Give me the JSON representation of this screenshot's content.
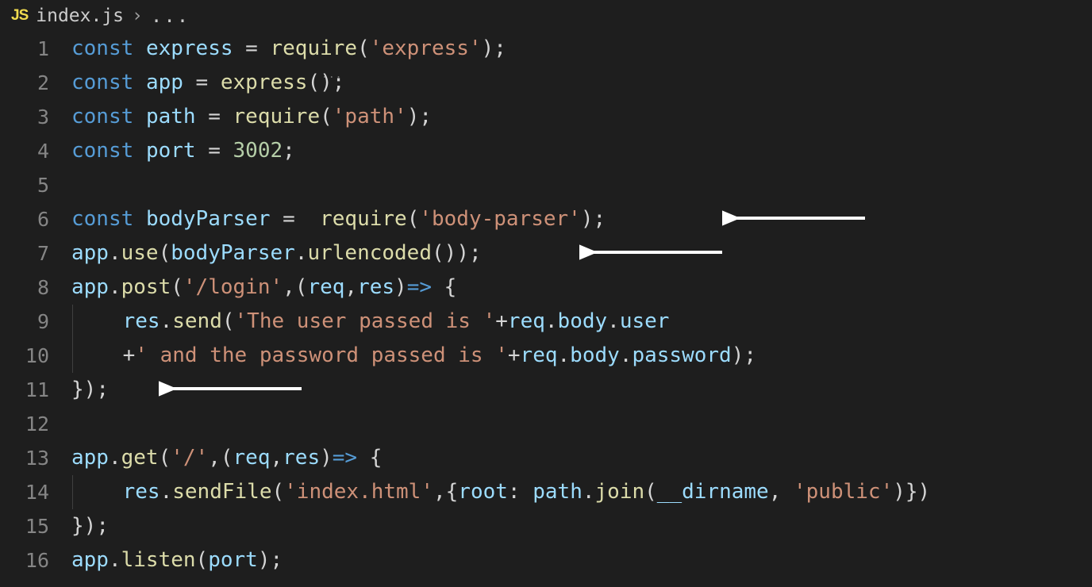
{
  "breadcrumb": {
    "fileIcon": "JS",
    "fileName": "index.js",
    "chevron": "›",
    "dots": "..."
  },
  "gutter": {
    "numbers": [
      "1",
      "2",
      "3",
      "4",
      "5",
      "6",
      "7",
      "8",
      "9",
      "10",
      "11",
      "12",
      "13",
      "14",
      "15",
      "16"
    ]
  },
  "code": {
    "l1": {
      "kw": "const",
      "var": "express",
      "eq": " = ",
      "fn": "require",
      "open": "(",
      "str": "'express'",
      "close": ")",
      "semi": ";"
    },
    "l2": {
      "kw": "const",
      "var": "app",
      "eq": " = ",
      "fn": "express",
      "open": "(",
      "close": ")",
      "semi": ";"
    },
    "l3": {
      "kw": "const",
      "var": "path",
      "eq": " = ",
      "fn": "require",
      "open": "(",
      "str": "'path'",
      "close": ")",
      "semi": ";"
    },
    "l4": {
      "kw": "const",
      "var": "port",
      "eq": " = ",
      "num": "3002",
      "semi": ";"
    },
    "l6": {
      "kw": "const",
      "var": "bodyParser",
      "eq": " =  ",
      "fn": "require",
      "open": "(",
      "str": "'body-parser'",
      "close": ")",
      "semi": ";"
    },
    "l7": {
      "obj": "app",
      "dot1": ".",
      "fn1": "use",
      "open1": "(",
      "var": "bodyParser",
      "dot2": ".",
      "fn2": "urlencoded",
      "open2": "(",
      "close2": ")",
      "close1": ")",
      "semi": ";"
    },
    "l8": {
      "obj": "app",
      "dot": ".",
      "fn": "post",
      "open": "(",
      "str": "'/login'",
      "comma": ",",
      "openp": "(",
      "p1": "req",
      "pcomma": ",",
      "p2": "res",
      "closep": ")",
      "arrow": "=>",
      "brace": " {"
    },
    "l9": {
      "indent": "    ",
      "obj": "res",
      "dot": ".",
      "fn": "send",
      "open": "(",
      "str": "'The user passed is '",
      "plus": "+",
      "obj2": "req",
      "dot2": ".",
      "prop": "body",
      "dot3": ".",
      "prop2": "user"
    },
    "l10": {
      "indent": "    ",
      "plus": "+",
      "str": "' and the password passed is '",
      "plus2": "+",
      "obj": "req",
      "dot": ".",
      "prop": "body",
      "dot2": ".",
      "prop2": "password",
      "close": ")",
      "semi": ";"
    },
    "l11": {
      "close": "}",
      "closep": ")",
      "semi": ";"
    },
    "l13": {
      "obj": "app",
      "dot": ".",
      "fn": "get",
      "open": "(",
      "str": "'/'",
      "comma": ",",
      "openp": "(",
      "p1": "req",
      "pcomma": ",",
      "p2": "res",
      "closep": ")",
      "arrow": "=>",
      "brace": " {"
    },
    "l14": {
      "indent": "    ",
      "obj": "res",
      "dot": ".",
      "fn": "sendFile",
      "open": "(",
      "str": "'index.html'",
      "comma": ",",
      "brace": "{",
      "prop": "root",
      "colon": ": ",
      "obj2": "path",
      "dot2": ".",
      "fn2": "join",
      "open2": "(",
      "var": "__dirname",
      "comma2": ", ",
      "str2": "'public'",
      "close2": ")",
      "braceclose": "}",
      "close": ")"
    },
    "l15": {
      "close": "}",
      "closep": ")",
      "semi": ";"
    },
    "l16": {
      "obj": "app",
      "dot": ".",
      "fn": "listen",
      "open": "(",
      "var": "port",
      "close": ")",
      "semi": ";"
    }
  },
  "annotations": {
    "arrow1": {
      "line": 6
    },
    "arrow2": {
      "line": 7
    },
    "arrow3": {
      "line": 11
    }
  }
}
